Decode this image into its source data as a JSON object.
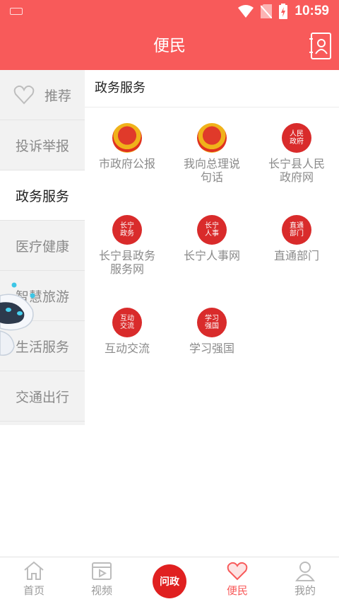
{
  "status_bar": {
    "time": "10:59"
  },
  "header": {
    "title": "便民"
  },
  "sidebar": {
    "items": [
      {
        "label": "推荐"
      },
      {
        "label": "投诉举报"
      },
      {
        "label": "政务服务"
      },
      {
        "label": "医疗健康"
      },
      {
        "label": "智慧旅游"
      },
      {
        "label": "生活服务"
      },
      {
        "label": "交通出行"
      }
    ],
    "active_index": 2
  },
  "main": {
    "section_title": "政务服务",
    "tiles": [
      {
        "label": "市政府公报",
        "emblem": "national-emblem-icon"
      },
      {
        "label": "我向总理说句话",
        "emblem": "national-emblem-icon"
      },
      {
        "label": "长宁县人民政府网",
        "badge_text": "人民政府"
      },
      {
        "label": "长宁县政务服务网",
        "badge_text": "长宁政务"
      },
      {
        "label": "长宁人事网",
        "badge_text": "长宁人事"
      },
      {
        "label": "直通部门",
        "badge_text": "直通部门"
      },
      {
        "label": "互动交流",
        "badge_text": "互动交流"
      },
      {
        "label": "学习强国",
        "badge_text": "学习强国"
      }
    ]
  },
  "tabbar": {
    "items": [
      {
        "label": "首页",
        "icon": "home-icon"
      },
      {
        "label": "视频",
        "icon": "video-icon"
      },
      {
        "label": "",
        "badge_text": "问政"
      },
      {
        "label": "便民",
        "icon": "heart-icon"
      },
      {
        "label": "我的",
        "icon": "user-icon"
      }
    ],
    "active_index": 3
  },
  "colors": {
    "brand": "#f85a5a",
    "badge": "#d92b2b"
  }
}
